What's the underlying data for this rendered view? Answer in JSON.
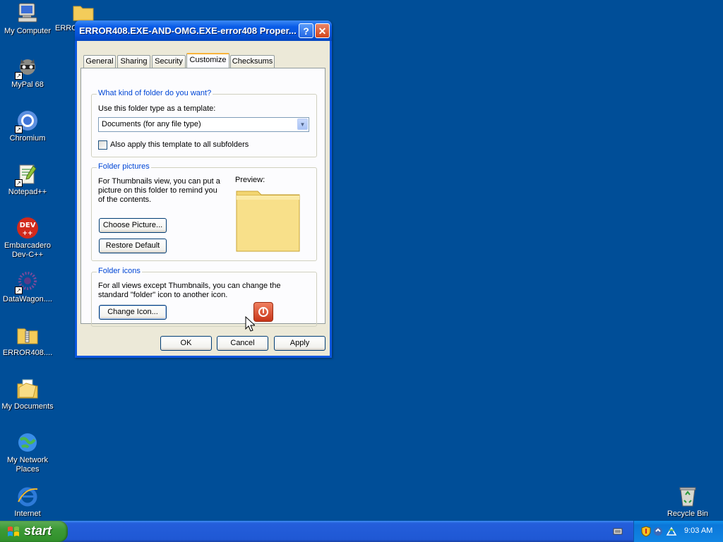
{
  "desktop": {
    "icons": [
      {
        "label": "My Computer"
      },
      {
        "label": "MyPal 68"
      },
      {
        "label": "Chromium"
      },
      {
        "label": "Notepad++"
      },
      {
        "label": "Embarcadero Dev-C++"
      },
      {
        "label": "DataWagon...."
      },
      {
        "label": "ERROR408...."
      },
      {
        "label": "My Documents"
      },
      {
        "label": "My Network Places"
      },
      {
        "label": "Internet"
      },
      {
        "label": "Recycle Bin"
      },
      {
        "label": "ERRO"
      }
    ],
    "background": "#004e98"
  },
  "dialog": {
    "title": "ERROR408.EXE-AND-OMG.EXE-error408 Proper...",
    "help_glyph": "?",
    "close_glyph": "✕",
    "tabs": [
      {
        "label": "General"
      },
      {
        "label": "Sharing"
      },
      {
        "label": "Security"
      },
      {
        "label": "Customize"
      },
      {
        "label": "Checksums"
      }
    ],
    "active_tab": "Customize",
    "folder_type": {
      "legend": "What kind of folder do you want?",
      "template_label": "Use this folder type as a template:",
      "template_value": "Documents (for any file type)",
      "subfolders_label": "Also apply this template to all subfolders",
      "subfolders_checked": false
    },
    "folder_pictures": {
      "legend": "Folder pictures",
      "description": "For Thumbnails view, you can put a picture on this folder to remind you of the contents.",
      "preview_label": "Preview:",
      "choose_picture": "Choose Picture...",
      "restore_default": "Restore Default"
    },
    "folder_icons": {
      "legend": "Folder icons",
      "description": "For all views except Thumbnails, you can change the standard \"folder\" icon to another icon.",
      "change_icon": "Change Icon..."
    },
    "buttons": {
      "ok": "OK",
      "cancel": "Cancel",
      "apply": "Apply"
    }
  },
  "taskbar": {
    "start_label": "start",
    "clock": "9:03 AM"
  },
  "colors": {
    "title_bar": "#0653d8",
    "legend_text": "#0046d5",
    "active_tab_accent": "#f8b33a",
    "start_button": "#3c9a36"
  }
}
